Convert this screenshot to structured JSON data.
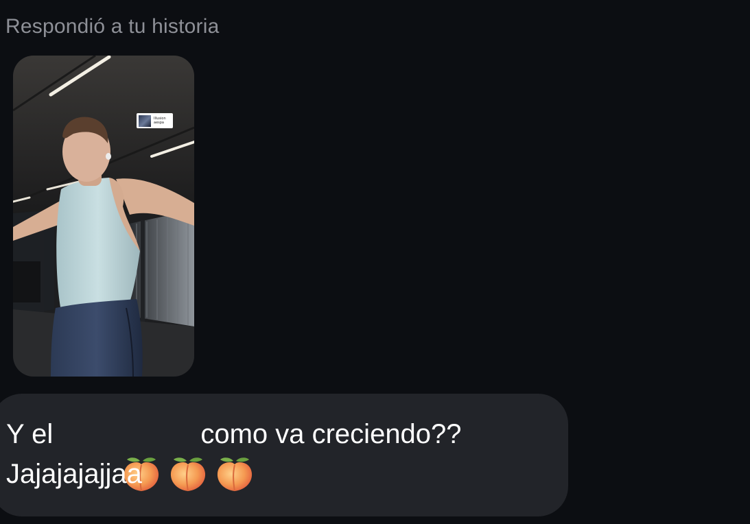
{
  "header": {
    "reply_label": "Respondió a tu historia"
  },
  "story": {
    "sticker_line1": "Illusion",
    "sticker_line2": "aespa"
  },
  "message": {
    "text_before": "Y el ",
    "emoji": [
      "peach-emoji",
      "peach-emoji",
      "peach-emoji"
    ],
    "text_after": "como va creciendo??",
    "line2": "Jajajajajjaa"
  },
  "colors": {
    "background": "#0c0e12",
    "bubble": "#222429",
    "label": "#8e9097",
    "text": "#ffffff"
  }
}
